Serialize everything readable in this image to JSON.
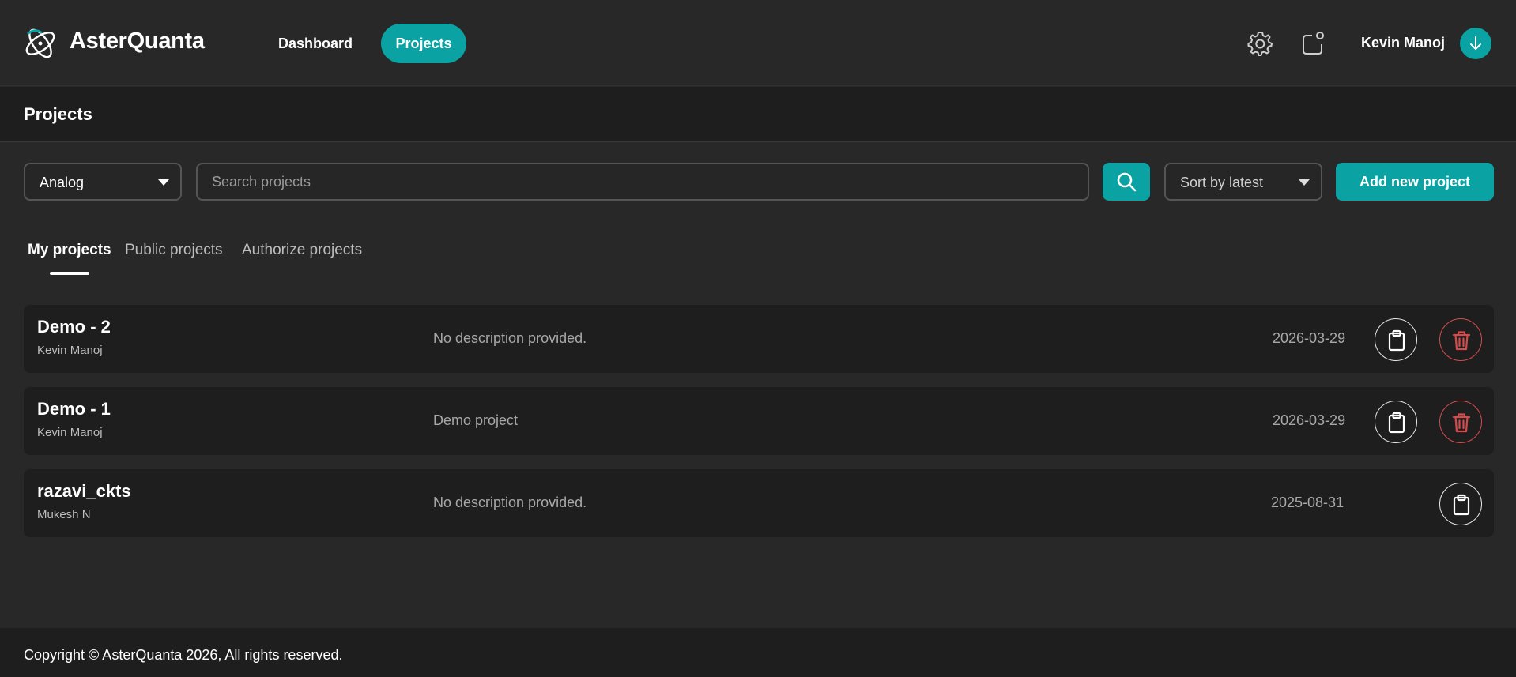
{
  "header": {
    "brand": "AsterQuanta",
    "nav": [
      {
        "label": "Dashboard",
        "active": false
      },
      {
        "label": "Projects",
        "active": true
      }
    ],
    "username": "Kevin Manoj",
    "icons": {
      "settings": "gear-icon",
      "notifications": "notification-icon",
      "avatar": "arrow-down-icon"
    }
  },
  "page": {
    "title": "Projects"
  },
  "filters": {
    "category": "Analog",
    "search_placeholder": "Search projects",
    "sort": "Sort by latest",
    "add_label": "Add new project"
  },
  "tabs": [
    {
      "label": "My projects",
      "active": true
    },
    {
      "label": "Public projects",
      "active": false
    },
    {
      "label": "Authorize projects",
      "active": false
    }
  ],
  "projects": [
    {
      "name": "Demo - 2",
      "owner": "Kevin Manoj",
      "description": "No description provided.",
      "date": "2026-03-29",
      "deletable": true
    },
    {
      "name": "Demo - 1",
      "owner": "Kevin Manoj",
      "description": "Demo project",
      "date": "2026-03-29",
      "deletable": true
    },
    {
      "name": "razavi_ckts",
      "owner": "Mukesh N",
      "description": "No description provided.",
      "date": "2025-08-31",
      "deletable": false
    }
  ],
  "footer": {
    "text": "Copyright © AsterQuanta 2026, All rights reserved."
  },
  "colors": {
    "accent": "#0aa2a2",
    "danger": "#d84a4a",
    "background": "#282828",
    "panel": "#1e1e1e"
  }
}
